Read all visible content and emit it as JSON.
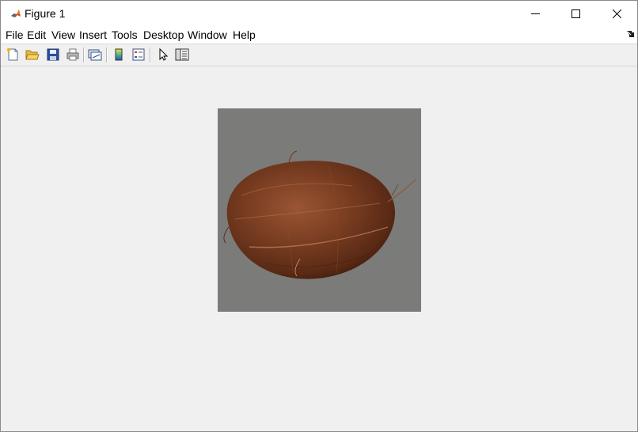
{
  "window": {
    "title": "Figure 1",
    "controls": {
      "minimize_icon": "minimize-icon",
      "maximize_icon": "maximize-icon",
      "close_icon": "close-icon"
    }
  },
  "menubar": {
    "items": [
      {
        "label": "File"
      },
      {
        "label": "Edit"
      },
      {
        "label": "View"
      },
      {
        "label": "Insert"
      },
      {
        "label": "Tools"
      },
      {
        "label": "Desktop"
      },
      {
        "label": "Window"
      },
      {
        "label": "Help"
      }
    ]
  },
  "toolbar": {
    "buttons": [
      {
        "icon": "new-figure-icon"
      },
      {
        "icon": "open-file-icon"
      },
      {
        "icon": "save-icon"
      },
      {
        "icon": "print-icon"
      },
      {
        "icon": "link-plot-icon"
      },
      {
        "icon": "insert-colorbar-icon"
      },
      {
        "icon": "insert-legend-icon"
      },
      {
        "icon": "edit-plot-icon"
      },
      {
        "icon": "property-inspector-icon"
      }
    ]
  },
  "figure": {
    "image_subject": "coconut",
    "image_background": "#7b7b79"
  },
  "colors": {
    "titlebar_bg": "#ffffff",
    "window_bg": "#f0f0f0",
    "image_bg": "#7b7b79",
    "coconut_brown": "#6e3a20"
  }
}
